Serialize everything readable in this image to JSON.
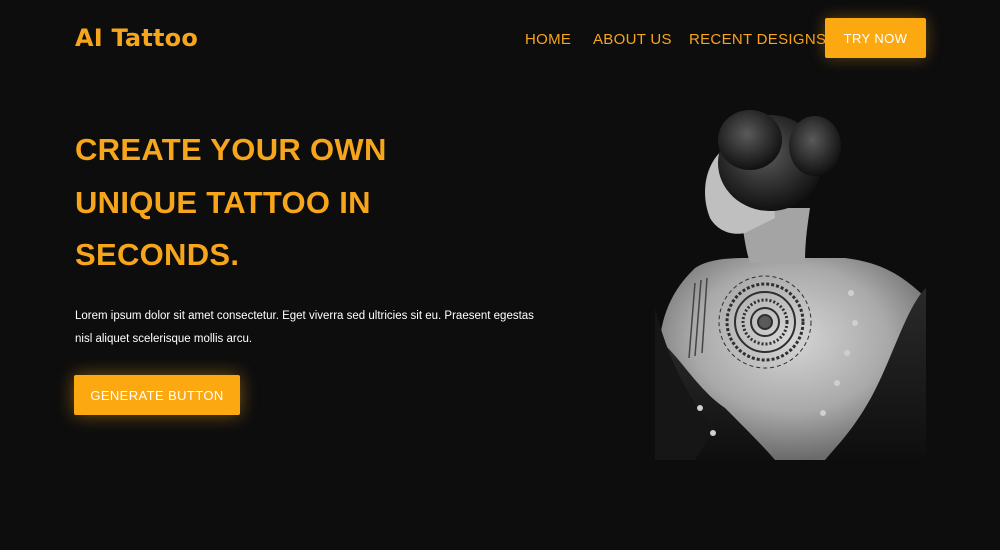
{
  "header": {
    "logo": "AI Tattoo",
    "nav": {
      "home": "HOME",
      "about": "ABOUT US",
      "recent": "RECENT DESIGNS"
    },
    "cta": "TRY NOW"
  },
  "hero": {
    "title_lines": [
      "CREATE YOUR OWN",
      "UNIQUE TATTOO IN",
      "SECONDS."
    ],
    "description": "Lorem ipsum dolor sit amet consectetur. Eget viverra sed ultricies sit eu. Praesent egestas nisl aliquet scelerisque mollis arcu.",
    "button": "GENERATE BUTTON"
  },
  "image": {
    "icon": "tattooed-woman-photo"
  },
  "colors": {
    "background": "#0d0d0e",
    "accent": "#fca811",
    "accent_text": "#f7a51b",
    "text": "#ffffff"
  }
}
